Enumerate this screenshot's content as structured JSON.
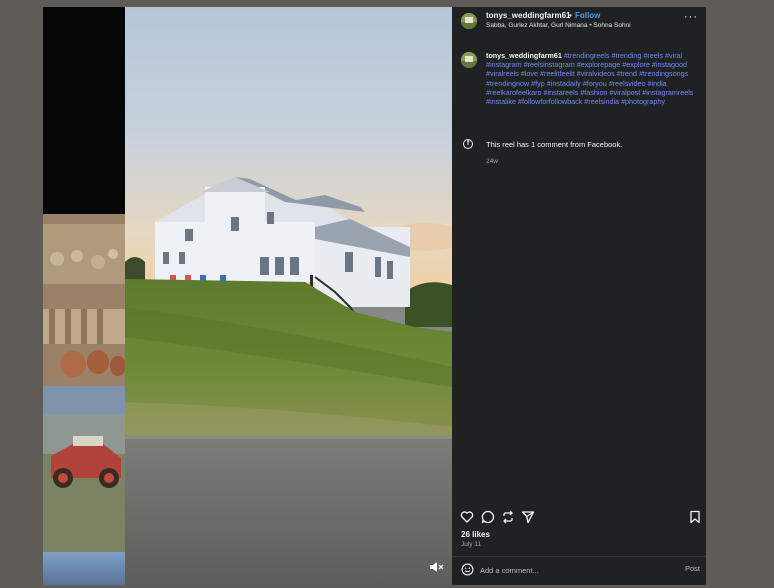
{
  "header": {
    "username": "tonys_weddingfarm61",
    "separator": "•",
    "follow_label": "Follow",
    "audio_line": "Sabba, Gurlez Akhtar, Gurl Nimana • Sohna Sohni",
    "more_label": "···"
  },
  "caption": {
    "username": "tonys_weddingfarm61",
    "hashtags": [
      "#trendingreels",
      "#trending",
      "#reels",
      "#viral",
      "#instagram",
      "#reelsinstagram",
      "#explorepage",
      "#explore",
      "#instagood",
      "#viralreels",
      "#love",
      "#reelitfeelit",
      "#viralvideos",
      "#trend",
      "#trendingsongs",
      "#trendingnow",
      "#fyp",
      "#instadaily",
      "#foryou",
      "#reelsvideo",
      "#india",
      "#reelkarofeelkaro",
      "#instareels",
      "#fashion",
      "#viralpost",
      "#instagramreels",
      "#instalike",
      "#followforfollowback",
      "#reelsindia",
      "#photography"
    ],
    "age": "24w"
  },
  "facebook": {
    "icon_letter": "f",
    "text": "This reel has 1 comment from Facebook."
  },
  "actions": {
    "icons": [
      "heart-icon",
      "comment-icon",
      "repost-icon",
      "share-icon",
      "bookmark-icon"
    ]
  },
  "stats": {
    "likes": "26 likes",
    "date": "July 11"
  },
  "comment": {
    "placeholder": "Add a comment...",
    "post_label": "Post"
  },
  "colors": {
    "panel_bg": "#202123",
    "link_blue": "#4a9bf0",
    "hashtag": "#6f8cf5",
    "backdrop": "#5f5b56"
  }
}
